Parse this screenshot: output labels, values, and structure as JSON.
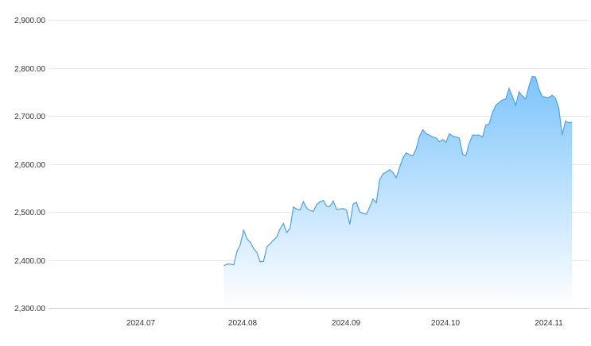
{
  "chart_data": {
    "type": "area",
    "title": "",
    "xlabel": "",
    "ylabel": "",
    "ylim": [
      2300,
      2900
    ],
    "y_ticks": [
      "2,300.00",
      "2,400.00",
      "2,500.00",
      "2,600.00",
      "2,700.00",
      "2,800.00",
      "2,900.00"
    ],
    "x_ticks": [
      "2024.07",
      "2024.08",
      "2024.09",
      "2024.10",
      "2024.11"
    ],
    "grid": true,
    "legend": "none",
    "colors": {
      "line": "#4aa3e8",
      "fill_top": "#7ec4fb",
      "fill_bottom": "#ffffff",
      "grid": "#e6e6e6"
    },
    "x": [
      "2024-07-26",
      "2024-07-27",
      "2024-07-28",
      "2024-07-29",
      "2024-07-30",
      "2024-07-31",
      "2024-08-01",
      "2024-08-02",
      "2024-08-03",
      "2024-08-04",
      "2024-08-05",
      "2024-08-06",
      "2024-08-07",
      "2024-08-08",
      "2024-08-09",
      "2024-08-10",
      "2024-08-11",
      "2024-08-12",
      "2024-08-13",
      "2024-08-14",
      "2024-08-15",
      "2024-08-16",
      "2024-08-17",
      "2024-08-18",
      "2024-08-19",
      "2024-08-20",
      "2024-08-21",
      "2024-08-22",
      "2024-08-23",
      "2024-08-24",
      "2024-08-25",
      "2024-08-26",
      "2024-08-27",
      "2024-08-28",
      "2024-08-29",
      "2024-08-30",
      "2024-08-31",
      "2024-09-01",
      "2024-09-02",
      "2024-09-03",
      "2024-09-04",
      "2024-09-05",
      "2024-09-06",
      "2024-09-07",
      "2024-09-08",
      "2024-09-09",
      "2024-09-10",
      "2024-09-11",
      "2024-09-12",
      "2024-09-13",
      "2024-09-14",
      "2024-09-15",
      "2024-09-16",
      "2024-09-17",
      "2024-09-18",
      "2024-09-19",
      "2024-09-20",
      "2024-09-21",
      "2024-09-22",
      "2024-09-23",
      "2024-09-24",
      "2024-09-25",
      "2024-09-26",
      "2024-09-27",
      "2024-09-28",
      "2024-09-29",
      "2024-09-30",
      "2024-10-01",
      "2024-10-02",
      "2024-10-03",
      "2024-10-04",
      "2024-10-05",
      "2024-10-06",
      "2024-10-07",
      "2024-10-08",
      "2024-10-09",
      "2024-10-10",
      "2024-10-11",
      "2024-10-12",
      "2024-10-13",
      "2024-10-14",
      "2024-10-15",
      "2024-10-16",
      "2024-10-17",
      "2024-10-18",
      "2024-10-19",
      "2024-10-20",
      "2024-10-21",
      "2024-10-22",
      "2024-10-23",
      "2024-10-24",
      "2024-10-25",
      "2024-10-26",
      "2024-10-27",
      "2024-10-28",
      "2024-10-29",
      "2024-10-30",
      "2024-10-31",
      "2024-11-01",
      "2024-11-02",
      "2024-11-03",
      "2024-11-04",
      "2024-11-05",
      "2024-11-06",
      "2024-11-07",
      "2024-11-08"
    ],
    "series": [
      {
        "values": [
          2388,
          2391,
          2391,
          2390,
          2418,
          2432,
          2462,
          2444,
          2437,
          2424,
          2415,
          2396,
          2397,
          2427,
          2434,
          2441,
          2448,
          2465,
          2476,
          2457,
          2466,
          2510,
          2506,
          2504,
          2521,
          2508,
          2503,
          2501,
          2515,
          2521,
          2524,
          2512,
          2511,
          2523,
          2505,
          2506,
          2507,
          2504,
          2474,
          2516,
          2520,
          2500,
          2497,
          2495,
          2510,
          2527,
          2519,
          2567,
          2579,
          2583,
          2588,
          2582,
          2571,
          2592,
          2612,
          2623,
          2619,
          2617,
          2631,
          2657,
          2671,
          2663,
          2660,
          2656,
          2654,
          2646,
          2651,
          2645,
          2663,
          2658,
          2656,
          2654,
          2620,
          2617,
          2643,
          2660,
          2660,
          2660,
          2656,
          2681,
          2683,
          2707,
          2722,
          2728,
          2733,
          2735,
          2757,
          2741,
          2722,
          2750,
          2742,
          2735,
          2762,
          2782,
          2781,
          2756,
          2740,
          2739,
          2738,
          2743,
          2737,
          2716,
          2660,
          2689,
          2686,
          2686
        ]
      }
    ]
  }
}
